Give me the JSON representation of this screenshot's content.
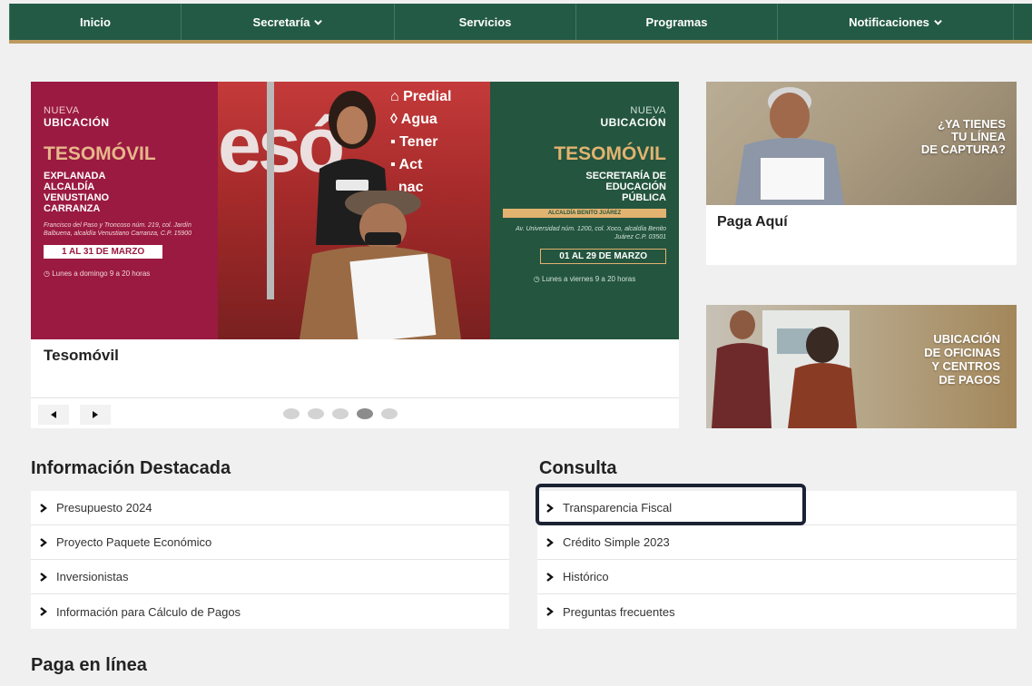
{
  "nav": {
    "items": [
      {
        "label": "Inicio",
        "dropdown": false
      },
      {
        "label": "Secretaría",
        "dropdown": true
      },
      {
        "label": "Servicios",
        "dropdown": false
      },
      {
        "label": "Programas",
        "dropdown": false
      },
      {
        "label": "Notificaciones",
        "dropdown": true
      }
    ]
  },
  "carousel": {
    "caption": "Tesomóvil",
    "slide_count": 5,
    "active_slide": 4,
    "left_panel": {
      "kicker": "NUEVA",
      "kicker2": "UBICACIÓN",
      "title": "TESOMÓVIL",
      "location": [
        "EXPLANADA",
        "ALCALDÍA",
        "VENUSTIANO",
        "CARRANZA"
      ],
      "address": "Francisco del Paso y Troncoso núm. 219, col. Jardín Balbuena, alcaldía Venustiano Carranza, C.P. 15900",
      "dates": "1 AL 31 DE MARZO",
      "hours": "Lunes a domingo 9 a 20 horas"
    },
    "middle_panel": {
      "big_letters": "esó",
      "services": [
        "Predial",
        "Agua",
        "Tener",
        "Act",
        "nac"
      ]
    },
    "right_panel": {
      "kicker": "NUEVA",
      "kicker2": "UBICACIÓN",
      "title": "TESOMÓVIL",
      "location": [
        "SECRETARÍA DE",
        "EDUCACIÓN",
        "PÚBLICA"
      ],
      "bar": "ALCALDÍA BENITO JUÁREZ",
      "address": "Av. Universidad núm. 1200, col. Xoco, alcaldía Benito Juárez C.P. 03501",
      "dates": "01 AL 29 DE MARZO",
      "hours": "Lunes a viernes 9 a 20 horas"
    }
  },
  "side_cards": {
    "pay": {
      "promo": [
        "¿YA TIENES",
        "TU LÍNEA",
        "DE CAPTURA?"
      ],
      "caption": "Paga Aquí"
    },
    "locations": {
      "promo": [
        "UBICACIÓN",
        "DE OFICINAS",
        "Y CENTROS",
        "DE PAGOS"
      ]
    }
  },
  "sections": {
    "info": {
      "title": "Información Destacada",
      "items": [
        "Presupuesto 2024",
        "Proyecto Paquete Económico",
        "Inversionistas",
        "Información para Cálculo de Pagos"
      ]
    },
    "consulta": {
      "title": "Consulta",
      "items": [
        "Transparencia Fiscal",
        "Crédito Simple 2023",
        "Histórico",
        "Preguntas frecuentes"
      ]
    },
    "paga": {
      "title": "Paga en línea"
    }
  },
  "colors": {
    "nav_green": "#235a46",
    "gold": "#bc9a5f",
    "maroon": "#9a1a42",
    "dark_green": "#24553f"
  }
}
